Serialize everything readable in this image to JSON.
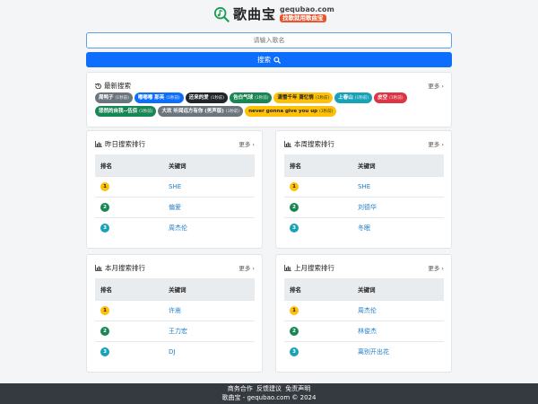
{
  "header": {
    "logo_text": "歌曲宝",
    "domain": "gequbao.com",
    "slogan": "找歌就用歌曲宝"
  },
  "search": {
    "placeholder": "请输入歌名",
    "button_label": "搜索"
  },
  "latest": {
    "title": "最新搜索",
    "more": "更多",
    "tags": [
      {
        "name": "周鸭子",
        "count": "(1秒前)",
        "color": "#6c757d"
      },
      {
        "name": "嘟嘟嘟 那英",
        "count": "(1秒前)",
        "color": "#0d6efd"
      },
      {
        "name": "还来的爱",
        "count": "(1秒前)",
        "color": "#212529"
      },
      {
        "name": "告白气球",
        "count": "(1秒前)",
        "color": "#198754"
      },
      {
        "name": "潇雪千年 萧忆情",
        "count": "(1秒前)",
        "color": "#ffc107",
        "text": "#222"
      },
      {
        "name": "上春山",
        "count": "(1秒前)",
        "color": "#17a2b8"
      },
      {
        "name": "皮空",
        "count": "(1秒前)",
        "color": "#dc3545"
      },
      {
        "name": "悲然的自我--伍佰",
        "count": "(1秒前)",
        "color": "#198754"
      },
      {
        "name": "大欢 听闻远方有你 (男声版)",
        "count": "(1秒前)",
        "color": "#6c757d"
      },
      {
        "name": "never gonna give you up",
        "count": "(1秒前)",
        "color": "#ffc107",
        "text": "#222"
      }
    ]
  },
  "rankings": [
    {
      "title": "昨日搜索排行",
      "more": "更多",
      "col_rank": "排名",
      "col_kw": "关键词",
      "rows": [
        {
          "rank": "1",
          "kw": "SHE"
        },
        {
          "rank": "2",
          "kw": "偏爱"
        },
        {
          "rank": "3",
          "kw": "周杰伦"
        }
      ]
    },
    {
      "title": "本周搜索排行",
      "more": "更多",
      "col_rank": "排名",
      "col_kw": "关键词",
      "rows": [
        {
          "rank": "1",
          "kw": "SHE"
        },
        {
          "rank": "2",
          "kw": "刘德华"
        },
        {
          "rank": "3",
          "kw": "冬眠"
        }
      ]
    },
    {
      "title": "本月搜索排行",
      "more": "更多",
      "col_rank": "排名",
      "col_kw": "关键词",
      "rows": [
        {
          "rank": "1",
          "kw": "许嵩"
        },
        {
          "rank": "2",
          "kw": "王力宏"
        },
        {
          "rank": "3",
          "kw": "DJ"
        }
      ]
    },
    {
      "title": "上月搜索排行",
      "more": "更多",
      "col_rank": "排名",
      "col_kw": "关键词",
      "rows": [
        {
          "rank": "1",
          "kw": "周杰伦"
        },
        {
          "rank": "2",
          "kw": "林俊杰"
        },
        {
          "rank": "3",
          "kw": "离别开出花"
        }
      ]
    }
  ],
  "badge_colors": {
    "1": "#ffc107",
    "2": "#198754",
    "3": "#17a2b8"
  },
  "footer": {
    "links": [
      "商务合作",
      "反馈建议",
      "免责声明"
    ],
    "copyright": "歌曲宝 - gequbao.com © 2024"
  }
}
